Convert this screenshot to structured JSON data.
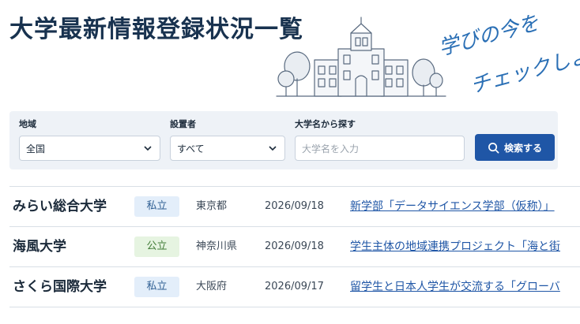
{
  "header": {
    "title": "大学最新情報登録状況一覧",
    "tagline": "学びの今をチェックしよう"
  },
  "filters": {
    "region": {
      "label": "地域",
      "value": "全国"
    },
    "founder": {
      "label": "設置者",
      "value": "すべて"
    },
    "name_search": {
      "label": "大学名から探す",
      "placeholder": "大学名を入力"
    },
    "search_button_label": "検索する"
  },
  "results": [
    {
      "name": "みらい総合大学",
      "type": "私立",
      "prefecture": "東京都",
      "date": "2026/09/18",
      "news": "新学部「データサイエンス学部（仮称）」"
    },
    {
      "name": "海風大学",
      "type": "公立",
      "prefecture": "神奈川県",
      "date": "2026/09/18",
      "news": "学生主体の地域連携プロジェクト「海と街"
    },
    {
      "name": "さくら国際大学",
      "type": "私立",
      "prefecture": "大阪府",
      "date": "2026/09/17",
      "news": "留学生と日本人学生が交流する「グローバ"
    }
  ],
  "colors": {
    "title": "#18324f",
    "accent": "#1f56a6",
    "private_badge": "#e3eefa",
    "public_badge": "#e6f4e1"
  },
  "icons": [
    "campus-illustration",
    "chevron-down-icon",
    "search-icon"
  ]
}
